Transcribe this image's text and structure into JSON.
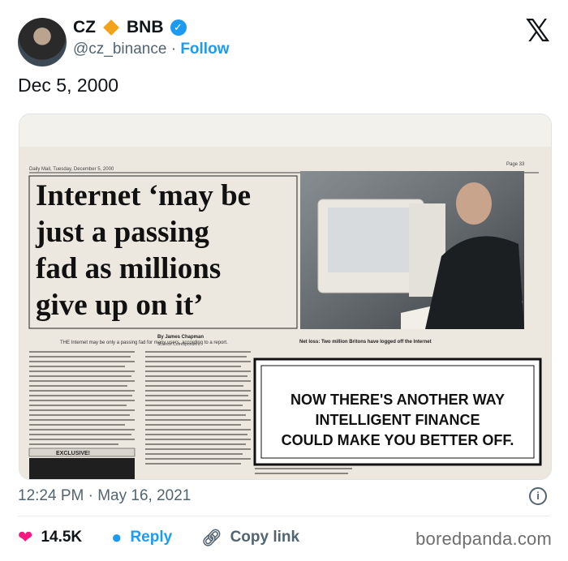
{
  "author": {
    "name": "CZ",
    "brand": "BNB",
    "handle": "@cz_binance",
    "separator": "·",
    "follow_label": "Follow",
    "verified_glyph": "✓"
  },
  "header": {
    "logo_glyph": "𝕏"
  },
  "tweet": {
    "text": "Dec 5, 2000"
  },
  "newspaper": {
    "masthead": "Daily Mail, Tuesday, December 5, 2000",
    "page": "Page 33",
    "headline_lines": [
      "Internet ‘may be",
      "just a passing",
      "fad as millions",
      "give up on it’"
    ],
    "byline": "By James Chapman",
    "byline_role": "Science Correspondent",
    "lede": "THE Internet may be only a passing fad for many users, according to a report.",
    "photo_caption": "Net loss: Two million Britons have logged off the Internet",
    "ad_lines": [
      "NOW THERE'S ANOTHER WAY",
      "INTELLIGENT FINANCE",
      "COULD MAKE YOU BETTER OFF."
    ],
    "exclusive_label": "EXCLUSIVE!"
  },
  "meta": {
    "timestamp": "12:24 PM · May 16, 2021",
    "info_glyph": "i"
  },
  "actions": {
    "likes": "14.5K",
    "reply_label": "Reply",
    "copy_label": "Copy link"
  },
  "watermark": "boredpanda.com",
  "colors": {
    "accent": "#1d9bf0",
    "like": "#f91880",
    "bnb": "#f3a31a",
    "paper": "#ece8df"
  }
}
